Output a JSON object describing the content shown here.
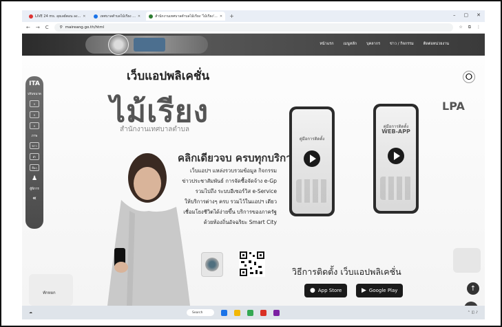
{
  "browser": {
    "tabs": [
      {
        "label": "LIVE 24 ms. ลุยเลย์ตอน ลง...",
        "active": false
      },
      {
        "label": "เทศบาลตำบลไม้เรียง ...",
        "active": false
      },
      {
        "label": "สำนักงานเทศบาลตำบลไม้เรียง 'ไม้เรียง'...",
        "active": true
      }
    ],
    "url": "maireang.go.th/html"
  },
  "site": {
    "nav": [
      "หน้าแรก",
      "เมนูหลัก",
      "บุคลากร",
      "ข่าว / กิจกรรม",
      "ติดต่อหน่วยงาน"
    ],
    "left_bar": {
      "label": "ปรับขนาด",
      "buttons": [
        "ก",
        "ก",
        "ก"
      ],
      "contrast": "ภาพ",
      "mode_buttons": [
        "ขาว",
        "ดำ"
      ],
      "other": "อื่นๆ",
      "person_label": "ผู้พิการ"
    }
  },
  "hero": {
    "title": "เว็บแอปพลิเคชั่น",
    "big_title": "ไม้เรียง",
    "subtitle": "สำนักงานเทศบาลตำบล",
    "headline": "คลิกเดียวจบ ครบทุกบริการ",
    "desc": [
      "เว็บแอปฯ แหล่งรวบรวมข้อมูล กิจกรรม",
      "ข่าวประชาสัมพันธ์ การจัดซื้อจัดจ้าง e-Gp",
      "รวมไปถึง ระบบอีเซอร์วิส e-Service",
      "ให้บริการต่างๆ ครบ รวมไว้ในแอปฯ เดียว",
      "เชื่อมโยงชีวิตได้ง่ายขึ้น บริการของภาครัฐ",
      "ด้วยท้องถิ่นอัจฉริยะ Smart City"
    ],
    "install_title": "วิธีการติดตั้ง เว็บแอปพลิเคชั่น",
    "app_store": "App Store",
    "google_play": "Google Play",
    "phone1_label": "คู่มือการติดตั้ง",
    "phone2_label": "คู่มือการติดตั้ง",
    "phone2_big": "WEB-APP"
  },
  "widgets": {
    "lpa": "LPA",
    "bot_left_label": "ทักหยก"
  },
  "taskbar": {
    "search": "Search"
  }
}
